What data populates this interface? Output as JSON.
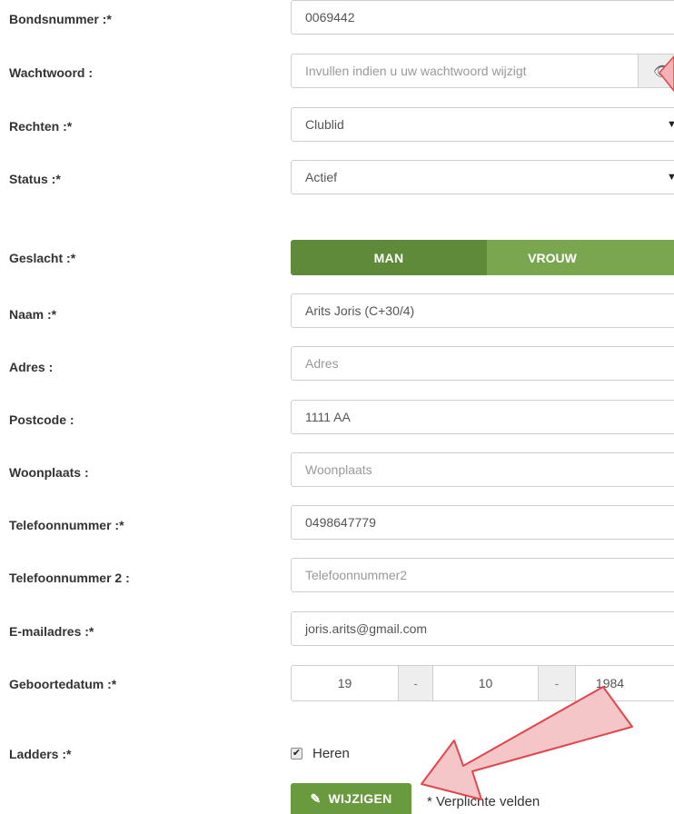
{
  "form": {
    "bondsnummer": {
      "label": "Bondsnummer :*",
      "value": "0069442"
    },
    "wachtwoord": {
      "label": "Wachtwoord :",
      "placeholder": "Invullen indien u uw wachtwoord wijzigt",
      "toggle_icon": "eye-icon"
    },
    "rechten": {
      "label": "Rechten :*",
      "selected": "Clublid"
    },
    "status": {
      "label": "Status :*",
      "selected": "Actief"
    },
    "geslacht": {
      "label": "Geslacht :*",
      "options": [
        "MAN",
        "VROUW"
      ],
      "selected": "MAN"
    },
    "naam": {
      "label": "Naam :*",
      "value": "Arits Joris (C+30/4)"
    },
    "adres": {
      "label": "Adres :",
      "placeholder": "Adres"
    },
    "postcode": {
      "label": "Postcode :",
      "value": "1111 AA"
    },
    "woonplaats": {
      "label": "Woonplaats :",
      "placeholder": "Woonplaats"
    },
    "telefoon": {
      "label": "Telefoonnummer :*",
      "value": "0498647779"
    },
    "telefoon2": {
      "label": "Telefoonnummer 2 :",
      "placeholder": "Telefoonnummer2"
    },
    "email": {
      "label": "E-mailadres :*",
      "value": "joris.arits@gmail.com"
    },
    "geboortedatum": {
      "label": "Geboortedatum :*",
      "day": "19",
      "month": "10",
      "year": "1984",
      "separator": "-"
    },
    "ladders": {
      "label": "Ladders :*",
      "option": "Heren",
      "checked": true
    }
  },
  "actions": {
    "submit_label": "WIJZIGEN",
    "submit_icon": "pencil-icon",
    "required_note": "* Verplichte velden"
  },
  "colors": {
    "accent_dark": "#5e8a3a",
    "accent_light": "#79a64f",
    "annotation_arrow": "#e0474c"
  }
}
